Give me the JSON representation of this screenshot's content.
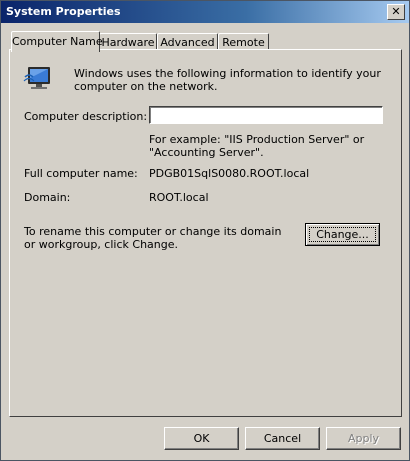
{
  "window": {
    "title": "System Properties",
    "close_glyph": "✕"
  },
  "tabs": [
    {
      "label": "Computer Name",
      "active": true
    },
    {
      "label": "Hardware",
      "active": false
    },
    {
      "label": "Advanced",
      "active": false
    },
    {
      "label": "Remote",
      "active": false
    }
  ],
  "panel": {
    "icon": "computer-icon",
    "intro": "Windows uses the following information to identify your computer on the network.",
    "description_label": "Computer description:",
    "description_value": "",
    "example_text": "For example: \"IIS Production Server\" or \"Accounting Server\".",
    "full_name_label": "Full computer name:",
    "full_name_value": "PDGB01SqlS0080.ROOT.local",
    "domain_label": "Domain:",
    "domain_value": "ROOT.local",
    "rename_text": "To rename this computer or change its domain or workgroup, click Change.",
    "change_button": "Change..."
  },
  "footer": {
    "ok_label": "OK",
    "cancel_label": "Cancel",
    "apply_label": "Apply",
    "apply_enabled": false
  },
  "colors": {
    "title_gradient_start": "#0a246a",
    "title_gradient_end": "#a6caf0",
    "face": "#d4d0c8"
  }
}
